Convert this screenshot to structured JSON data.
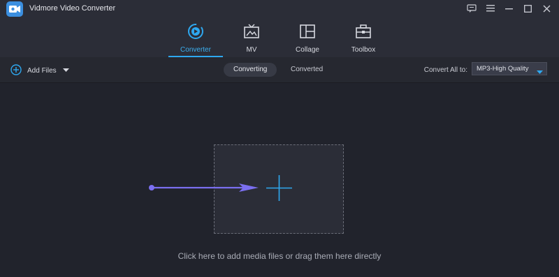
{
  "app": {
    "title": "Vidmore Video Converter",
    "icons": [
      "app-logo-icon",
      "feedback-icon",
      "menu-icon",
      "minimize-icon",
      "maximize-icon",
      "close-icon"
    ]
  },
  "nav": {
    "tabs": [
      {
        "label": "Converter",
        "icon": "converter-icon",
        "active": true
      },
      {
        "label": "MV",
        "icon": "mv-icon",
        "active": false
      },
      {
        "label": "Collage",
        "icon": "collage-icon",
        "active": false
      },
      {
        "label": "Toolbox",
        "icon": "toolbox-icon",
        "active": false
      }
    ]
  },
  "toolbar": {
    "add_files": "Add Files",
    "segments": [
      "Converting",
      "Converted"
    ],
    "convert_all_label": "Convert All to:",
    "format_value": "MP3-High Quality"
  },
  "main": {
    "hint": "Click here to add media files or drag them here directly"
  },
  "colors": {
    "accent": "#2ea8f0",
    "annotation_arrow": "#7b6ff0",
    "background": "#21232c"
  }
}
